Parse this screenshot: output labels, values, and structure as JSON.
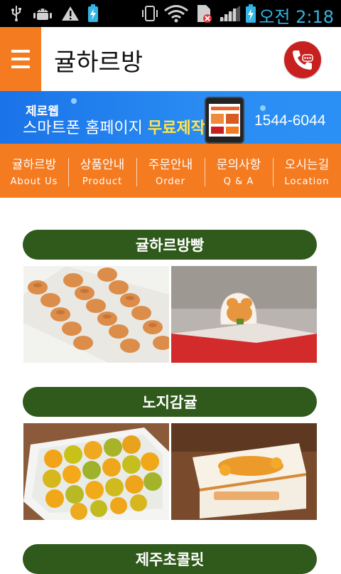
{
  "status_bar": {
    "time": "오전 2:18",
    "icons": [
      "usb-icon",
      "android-debug-icon",
      "warning-icon",
      "battery-charge-notice-icon",
      "vibrate-icon",
      "wifi-icon",
      "sim-off-icon",
      "signal-icon",
      "battery-charging-icon"
    ]
  },
  "header": {
    "title": "귤하르방",
    "menu_icon": "hamburger-menu-icon",
    "call_icon": "phone-call-icon"
  },
  "banner": {
    "brand": "제로웹",
    "slogan_prefix": "스마트폰 홈페이지 ",
    "slogan_highlight": "무료제작",
    "phone": "1544-6044"
  },
  "nav": {
    "items": [
      {
        "ko": "귤하르방",
        "en": "About Us"
      },
      {
        "ko": "상품안내",
        "en": "Product"
      },
      {
        "ko": "주문안내",
        "en": "Order"
      },
      {
        "ko": "문의사항",
        "en": "Q & A"
      },
      {
        "ko": "오시는길",
        "en": "Location"
      }
    ]
  },
  "sections": [
    {
      "title": "귤하르방빵"
    },
    {
      "title": "노지감귤"
    },
    {
      "title": "제주초콜릿"
    }
  ],
  "colors": {
    "orange": "#f47b20",
    "green": "#2f5a1b",
    "call_red": "#c8201e",
    "banner_blue": "#1a73e8",
    "status_blue": "#33b5e5"
  }
}
